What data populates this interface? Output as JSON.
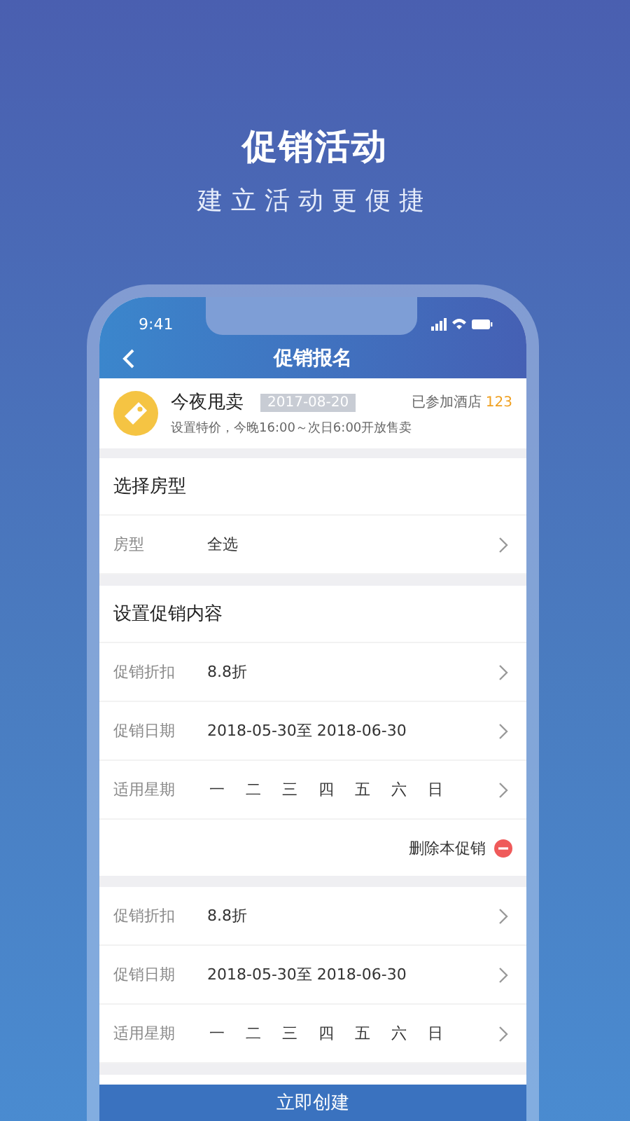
{
  "header": {
    "title": "促销活动",
    "subtitle": "建立活动更便捷"
  },
  "status_bar": {
    "time": "9:41"
  },
  "nav": {
    "title": "促销报名"
  },
  "event": {
    "name": "今夜甩卖",
    "date": "2017-08-20",
    "joined_label": "已参加酒店",
    "joined_count": "123",
    "description": "设置特价，今晚16:00～次日6:00开放售卖"
  },
  "sections": [
    {
      "title": "选择房型",
      "rows": [
        {
          "kind": "text",
          "label": "房型",
          "value": "全选"
        }
      ]
    },
    {
      "title": "设置促销内容",
      "rows": [
        {
          "kind": "text",
          "label": "促销折扣",
          "value": "8.8折"
        },
        {
          "kind": "text",
          "label": "促销日期",
          "value": "2018-05-30至 2018-06-30"
        },
        {
          "kind": "weekdays",
          "label": "适用星期",
          "days": [
            "一",
            "二",
            "三",
            "四",
            "五",
            "六",
            "日"
          ]
        }
      ],
      "delete": "删除本促销"
    },
    {
      "rows": [
        {
          "kind": "text",
          "label": "促销折扣",
          "value": "8.8折"
        },
        {
          "kind": "text",
          "label": "促销日期",
          "value": "2018-05-30至 2018-06-30"
        },
        {
          "kind": "weekdays",
          "label": "适用星期",
          "days": [
            "一",
            "二",
            "三",
            "四",
            "五",
            "六",
            "日"
          ]
        }
      ]
    }
  ],
  "create_button": "立即创建"
}
